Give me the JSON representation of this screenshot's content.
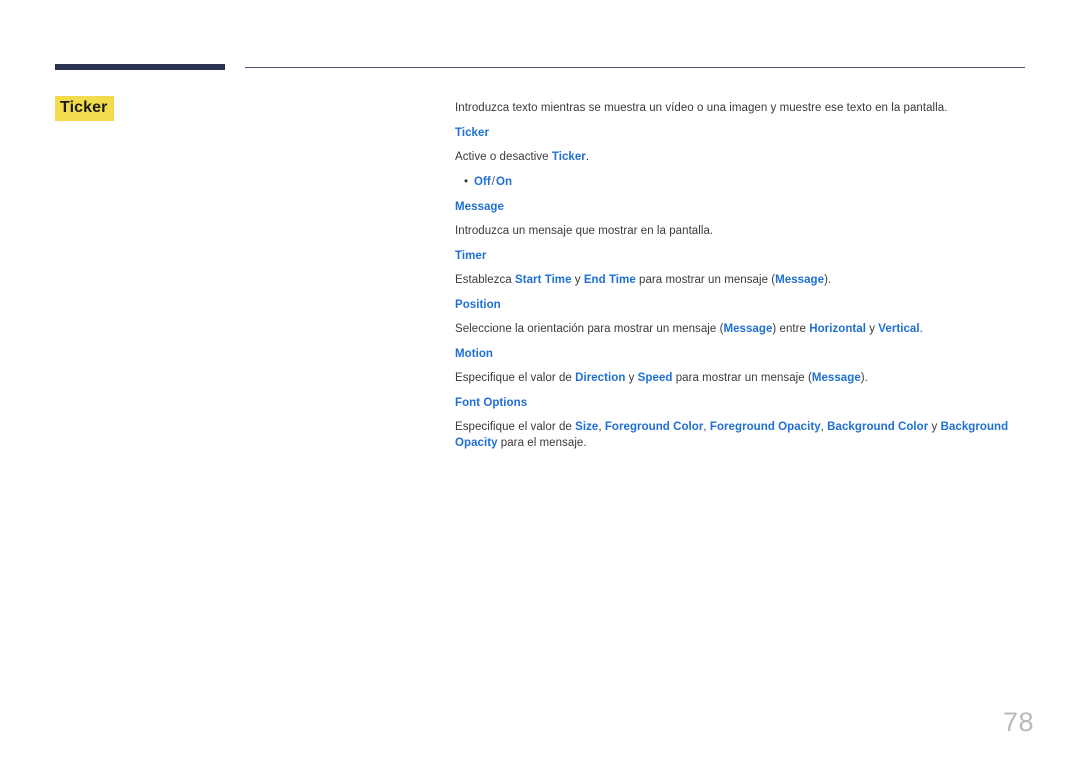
{
  "document": {
    "page_title": "Ticker",
    "page_number": "78",
    "accent_navy": "#2b3352",
    "accent_blue": "#1f6fd4",
    "highlight_yellow": "#f2dc4e",
    "body_color": "#3a3a3a"
  },
  "intro": {
    "text": "Introduzca texto mientras se muestra un vídeo o una imagen y muestre ese texto en la pantalla."
  },
  "sections": {
    "ticker": {
      "heading": "Ticker",
      "desc_before": "Active o desactive ",
      "desc_term": "Ticker",
      "desc_after": ".",
      "bullet": {
        "dot": "•",
        "option_off": "Off",
        "separator": "/",
        "option_on": "On"
      }
    },
    "message": {
      "heading": "Message",
      "desc": "Introduzca un mensaje que mostrar en la pantalla."
    },
    "timer": {
      "heading": "Timer",
      "p1": "Establezca ",
      "t1": "Start Time",
      "p2": " y ",
      "t2": "End Time",
      "p3": " para mostrar un mensaje (",
      "t3": "Message",
      "p4": ")."
    },
    "position": {
      "heading": "Position",
      "p1": "Seleccione la orientación para mostrar un mensaje (",
      "t1": "Message",
      "p2": ") entre ",
      "t2": "Horizontal",
      "p3": " y ",
      "t3": "Vertical",
      "p4": "."
    },
    "motion": {
      "heading": "Motion",
      "p1": "Especifique el valor de ",
      "t1": "Direction",
      "p2": " y ",
      "t2": "Speed",
      "p3": " para mostrar un mensaje (",
      "t3": "Message",
      "p4": ")."
    },
    "font_options": {
      "heading": "Font Options",
      "p1": "Especifique el valor de ",
      "t1": "Size",
      "p2": ", ",
      "t2": "Foreground Color",
      "p3": ", ",
      "t3": "Foreground Opacity",
      "p4": ", ",
      "t4": "Background Color",
      "p5": " y ",
      "t5": "Background Opacity",
      "p6": " para el mensaje."
    }
  }
}
